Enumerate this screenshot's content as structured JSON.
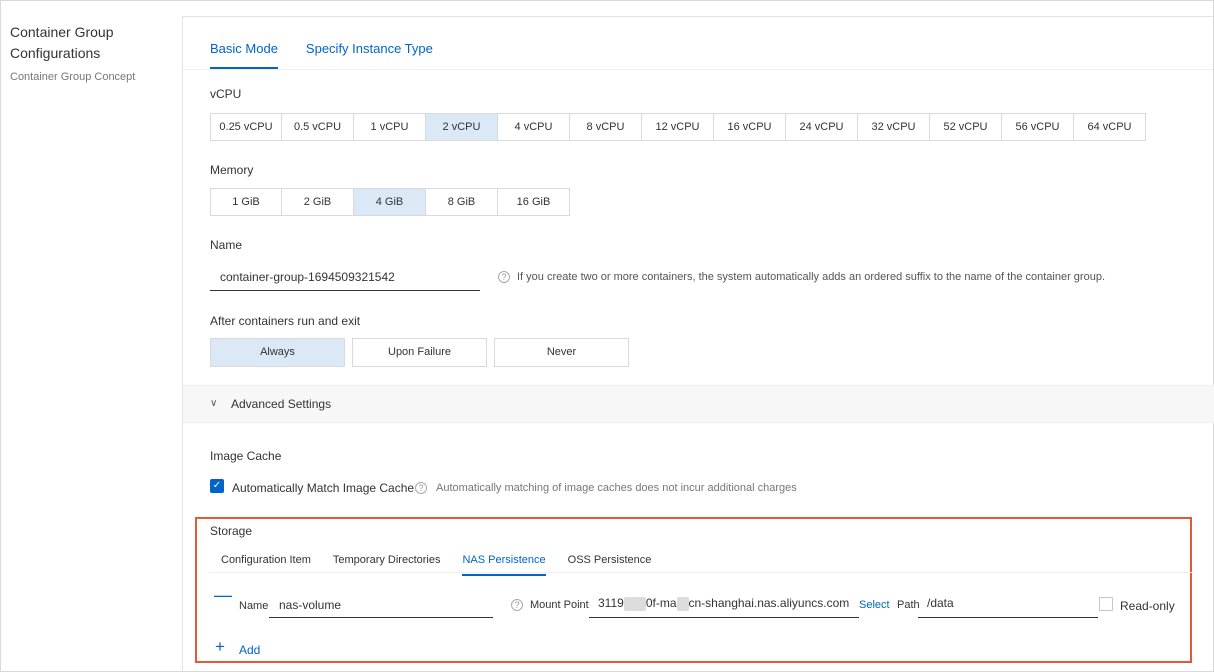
{
  "sidebar": {
    "title": "Container Group Configurations",
    "title_line1": "Container Group",
    "title_line2": "Configurations",
    "concept_link": "Container Group Concept"
  },
  "mode_tabs": [
    {
      "label": "Basic Mode",
      "active": true
    },
    {
      "label": "Specify Instance Type",
      "active": false
    }
  ],
  "vcpu": {
    "label": "vCPU",
    "options": [
      "0.25 vCPU",
      "0.5 vCPU",
      "1 vCPU",
      "2 vCPU",
      "4 vCPU",
      "8 vCPU",
      "12 vCPU",
      "16 vCPU",
      "24 vCPU",
      "32 vCPU",
      "52 vCPU",
      "56 vCPU",
      "64 vCPU"
    ],
    "selected": "2 vCPU"
  },
  "memory": {
    "label": "Memory",
    "options": [
      "1 GiB",
      "2 GiB",
      "4 GiB",
      "8 GiB",
      "16 GiB"
    ],
    "selected": "4 GiB"
  },
  "name": {
    "label": "Name",
    "value": "container-group-1694509321542",
    "help": "If you create two or more containers, the system automatically adds an ordered suffix to the name of the container group."
  },
  "restart": {
    "label": "After containers run and exit",
    "options": [
      "Always",
      "Upon Failure",
      "Never"
    ],
    "selected": "Always"
  },
  "advanced": {
    "label": "Advanced Settings"
  },
  "image_cache": {
    "label": "Image Cache",
    "checkbox_label": "Automatically Match Image Cache",
    "checked": true,
    "help": "Automatically matching of image caches does not incur additional charges"
  },
  "storage": {
    "label": "Storage",
    "tabs": [
      "Configuration Item",
      "Temporary Directories",
      "NAS Persistence",
      "OSS Persistence"
    ],
    "active_tab": "NAS Persistence",
    "nas": {
      "name_label": "Name",
      "name_value": "nas-volume",
      "mount_point_label": "Mount Point",
      "mount_point_part1": "3119",
      "mount_point_part2": "0f-ma",
      "mount_point_part3": "cn-shanghai.nas.aliyuncs.com",
      "select_label": "Select",
      "path_label": "Path",
      "path_value": "/data",
      "readonly_label": "Read-only",
      "readonly_checked": false
    },
    "add_label": "Add"
  },
  "colors": {
    "accent": "#0064c8",
    "selected_bg": "#dbe9f7",
    "highlight_border": "#e2593a"
  }
}
